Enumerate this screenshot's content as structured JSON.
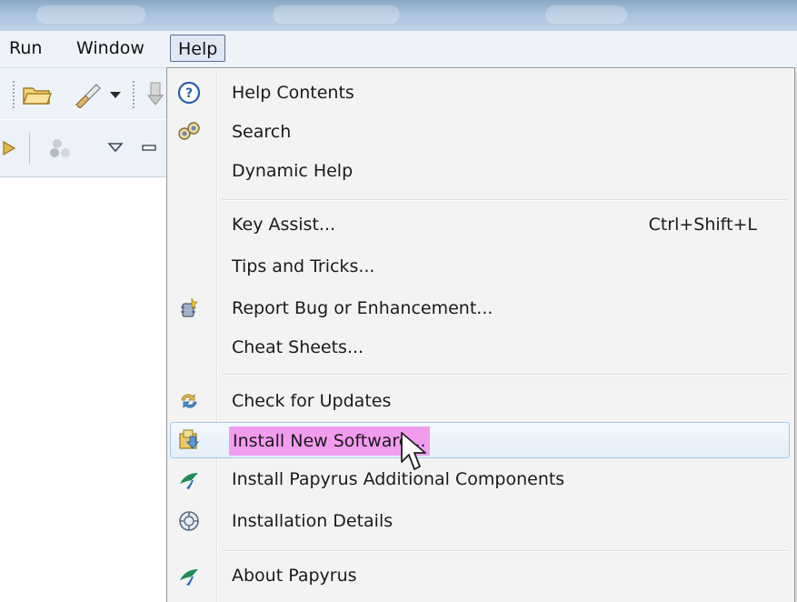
{
  "menubar": {
    "items": [
      {
        "label": "Run"
      },
      {
        "label": "Window"
      },
      {
        "label": "Help"
      }
    ]
  },
  "help_menu": {
    "items": [
      {
        "label": "Help Contents",
        "icon": "help-circle-icon"
      },
      {
        "label": "Search",
        "icon": "search-binoculars-icon"
      },
      {
        "label": "Dynamic Help",
        "icon": ""
      },
      {
        "label": "Key Assist...",
        "shortcut": "Ctrl+Shift+L",
        "icon": ""
      },
      {
        "label": "Tips and Tricks...",
        "icon": ""
      },
      {
        "label": "Report Bug or Enhancement...",
        "icon": "report-bug-icon"
      },
      {
        "label": "Cheat Sheets...",
        "icon": ""
      },
      {
        "label": "Check for Updates",
        "icon": "check-updates-icon"
      },
      {
        "label": "Install New Software...",
        "icon": "install-software-icon",
        "state": "hovered"
      },
      {
        "label": "Install Papyrus Additional Components",
        "icon": "papyrus-logo-icon"
      },
      {
        "label": "Installation Details",
        "icon": "installation-details-icon"
      },
      {
        "label": "About Papyrus",
        "icon": "papyrus-logo-icon"
      }
    ]
  },
  "colors": {
    "hover_highlight": "#f29cf0",
    "hover_border": "#a8cbe9",
    "menu_bg": "#f3f3f3",
    "menubar_bg": "#eef3fa"
  }
}
